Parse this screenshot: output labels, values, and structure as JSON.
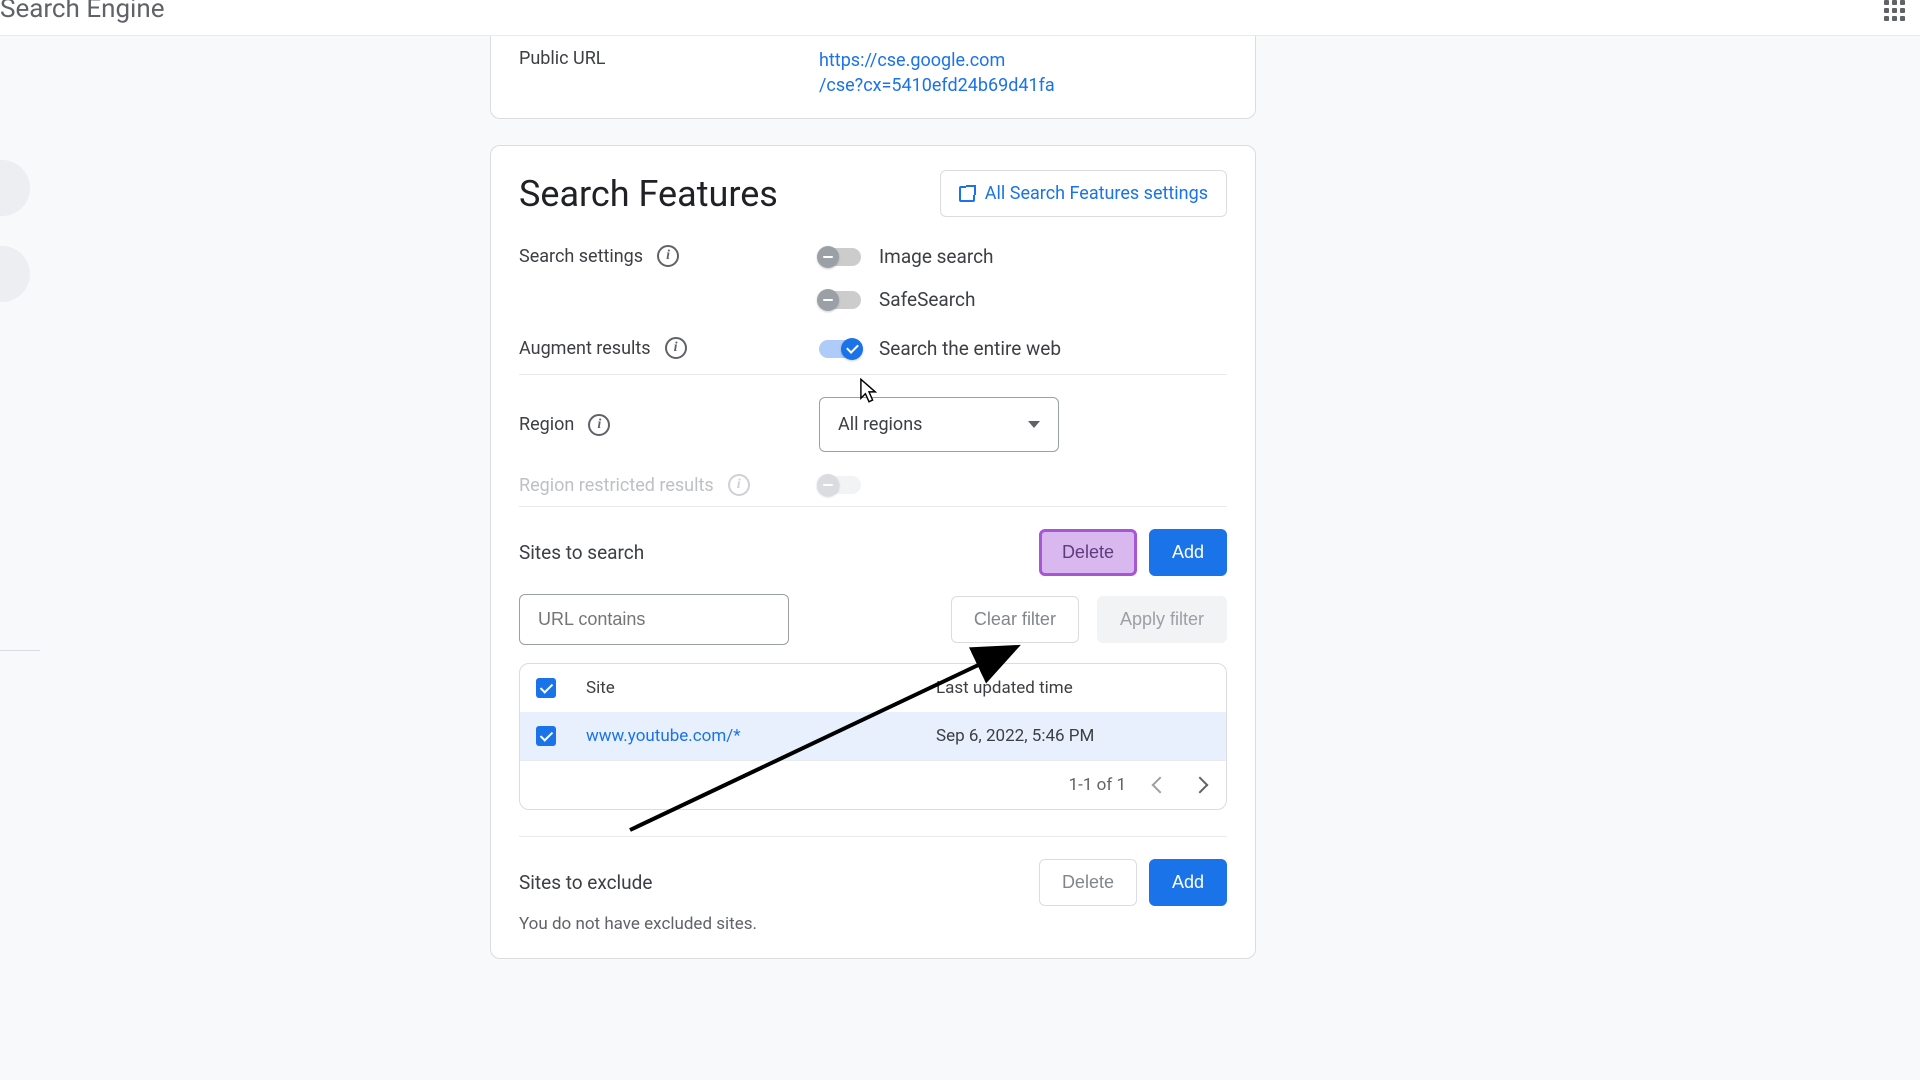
{
  "header": {
    "title": "Search Engine"
  },
  "public_url_card": {
    "label": "Public URL",
    "url_line1": "https://cse.google.com",
    "url_line2": "/cse?cx=5410efd24b69d41fa"
  },
  "features": {
    "title": "Search Features",
    "all_settings_label": "All Search Features settings",
    "search_settings_label": "Search settings",
    "toggles": {
      "image_search": "Image search",
      "safesearch": "SafeSearch"
    },
    "augment_label": "Augment results",
    "augment_toggle": "Search the entire web",
    "region_label": "Region",
    "region_value": "All regions",
    "region_restricted_label": "Region restricted results"
  },
  "sites": {
    "title": "Sites to search",
    "delete_label": "Delete",
    "add_label": "Add",
    "url_placeholder": "URL contains",
    "clear_filter": "Clear filter",
    "apply_filter": "Apply filter",
    "col_site": "Site",
    "col_time": "Last updated time",
    "rows": [
      {
        "site": "www.youtube.com/*",
        "time": "Sep 6, 2022, 5:46 PM"
      }
    ],
    "pager": "1-1 of 1"
  },
  "exclude": {
    "title": "Sites to exclude",
    "delete_label": "Delete",
    "add_label": "Add",
    "empty_msg": "You do not have excluded sites."
  }
}
